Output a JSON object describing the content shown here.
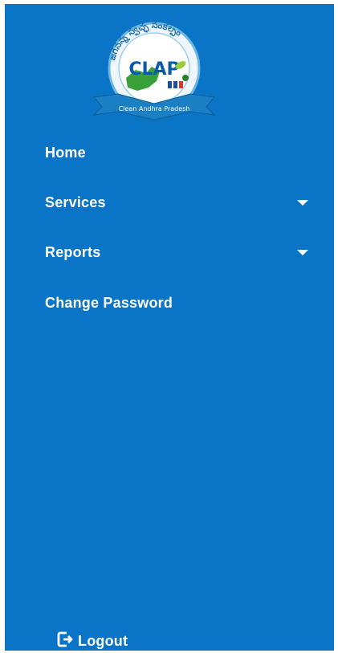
{
  "brand": {
    "logo_text": "CLAP",
    "logo_ribbon": "Clean Andhra Pradesh",
    "logo_top_text": "జగనన్న స్వచ్ఛ సంకల్పం"
  },
  "nav": {
    "items": [
      {
        "label": "Home",
        "has_dropdown": false
      },
      {
        "label": "Services",
        "has_dropdown": true
      },
      {
        "label": "Reports",
        "has_dropdown": true
      },
      {
        "label": "Change Password",
        "has_dropdown": false
      }
    ]
  },
  "footer": {
    "logout_label": "Logout",
    "logout_icon": "logout-icon"
  },
  "colors": {
    "sidebar_bg": "#0a74c6",
    "text": "#ffffff"
  }
}
